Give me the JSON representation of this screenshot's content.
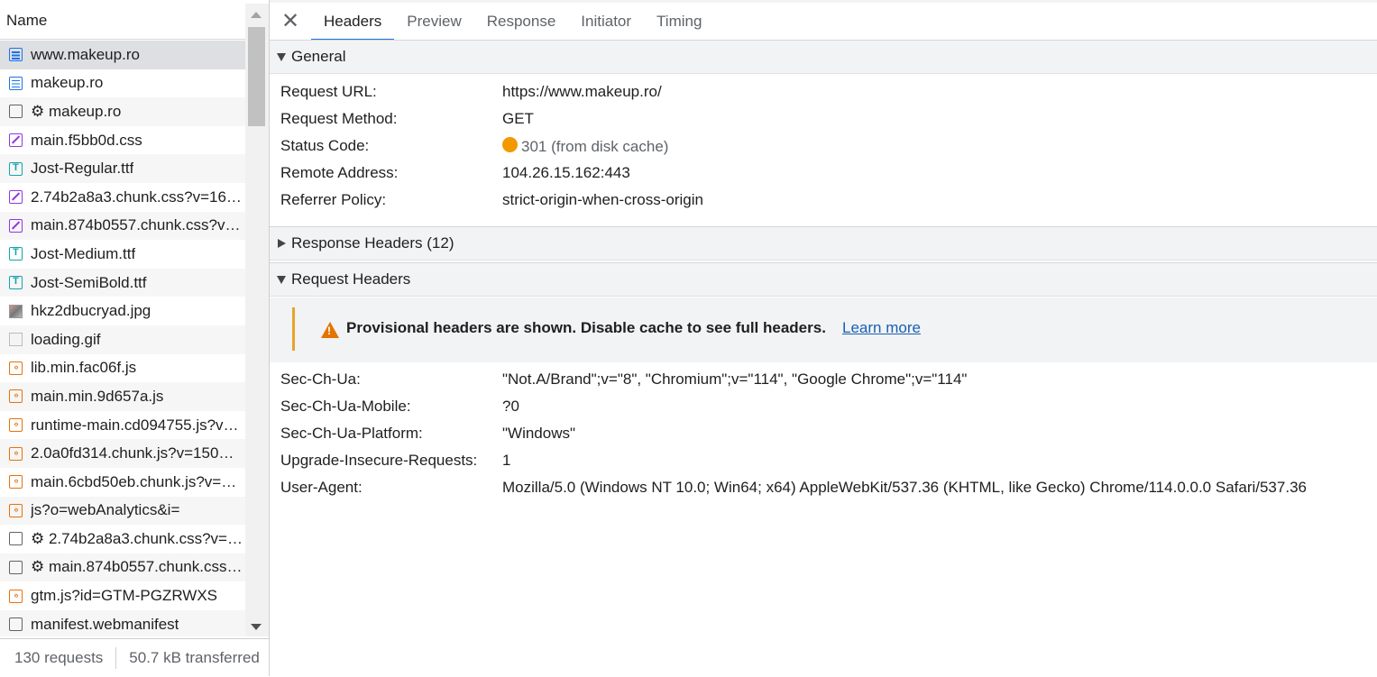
{
  "request_list": {
    "header": "Name",
    "rows": [
      {
        "icon": "document-icon",
        "name": "www.makeup.ro",
        "selected": true
      },
      {
        "icon": "document-icon",
        "name": "makeup.ro"
      },
      {
        "icon": "blank-file-icon",
        "name": "⚙ makeup.ro"
      },
      {
        "icon": "stylesheet-icon",
        "name": "main.f5bb0d.css"
      },
      {
        "icon": "font-icon",
        "name": "Jost-Regular.ttf"
      },
      {
        "icon": "stylesheet-icon",
        "name": "2.74b2a8a3.chunk.css?v=16…"
      },
      {
        "icon": "stylesheet-icon",
        "name": "main.874b0557.chunk.css?v…"
      },
      {
        "icon": "font-icon",
        "name": "Jost-Medium.ttf"
      },
      {
        "icon": "font-icon",
        "name": "Jost-SemiBold.ttf"
      },
      {
        "icon": "image-thumbnail-icon",
        "name": "hkz2dbucryad.jpg"
      },
      {
        "icon": "gif-thumbnail-icon",
        "name": "loading.gif"
      },
      {
        "icon": "script-icon",
        "name": "lib.min.fac06f.js"
      },
      {
        "icon": "script-icon",
        "name": "main.min.9d657a.js"
      },
      {
        "icon": "script-icon",
        "name": "runtime-main.cd094755.js?v…"
      },
      {
        "icon": "script-icon",
        "name": "2.0a0fd314.chunk.js?v=150…"
      },
      {
        "icon": "script-icon",
        "name": "main.6cbd50eb.chunk.js?v=…"
      },
      {
        "icon": "script-icon",
        "name": "js?o=webAnalytics&i="
      },
      {
        "icon": "blank-file-icon",
        "name": "⚙ 2.74b2a8a3.chunk.css?v=…"
      },
      {
        "icon": "blank-file-icon",
        "name": "⚙ main.874b0557.chunk.css…"
      },
      {
        "icon": "script-icon",
        "name": "gtm.js?id=GTM-PGZRWXS"
      },
      {
        "icon": "blank-file-icon",
        "name": "manifest.webmanifest"
      }
    ],
    "footer": {
      "requests": "130 requests",
      "transferred": "50.7 kB transferred"
    }
  },
  "tabs": {
    "close_symbol": "✕",
    "items": [
      "Headers",
      "Preview",
      "Response",
      "Initiator",
      "Timing"
    ],
    "active": "Headers"
  },
  "general": {
    "title": "General",
    "request_url_label": "Request URL:",
    "request_url": "https://www.makeup.ro/",
    "request_method_label": "Request Method:",
    "request_method": "GET",
    "status_code_label": "Status Code:",
    "status_code": "301 (from disk cache)",
    "status_color": "#f29900",
    "remote_address_label": "Remote Address:",
    "remote_address": "104.26.15.162:443",
    "referrer_policy_label": "Referrer Policy:",
    "referrer_policy": "strict-origin-when-cross-origin"
  },
  "response_headers": {
    "title": "Response Headers (12)"
  },
  "request_headers": {
    "title": "Request Headers",
    "warning": {
      "text": "Provisional headers are shown. Disable cache to see full headers.",
      "link": "Learn more"
    },
    "rows": [
      {
        "key": "Sec-Ch-Ua:",
        "value": "\"Not.A/Brand\";v=\"8\", \"Chromium\";v=\"114\", \"Google Chrome\";v=\"114\""
      },
      {
        "key": "Sec-Ch-Ua-Mobile:",
        "value": "?0"
      },
      {
        "key": "Sec-Ch-Ua-Platform:",
        "value": "\"Windows\""
      },
      {
        "key": "Upgrade-Insecure-Requests:",
        "value": "1"
      },
      {
        "key": "User-Agent:",
        "value": "Mozilla/5.0 (Windows NT 10.0; Win64; x64) AppleWebKit/537.36 (KHTML, like Gecko) Chrome/114.0.0.0 Safari/537.36"
      }
    ]
  },
  "colors": {
    "accent": "#1a73e8",
    "warning": "#e37400",
    "selected_row": "#dedfe3"
  }
}
